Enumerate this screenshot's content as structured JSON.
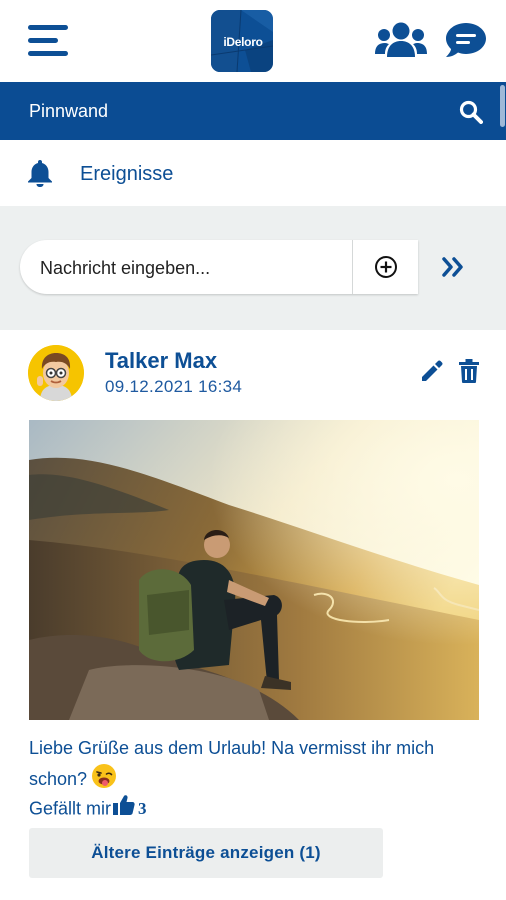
{
  "app": {
    "logo_text": "iDeloro",
    "brand_color": "#0b4c93"
  },
  "header": {
    "title": "Pinnwand",
    "icons": [
      "menu-icon",
      "users-icon",
      "chat-icon",
      "search-icon"
    ]
  },
  "events": {
    "label": "Ereignisse",
    "icon": "bell-icon"
  },
  "composer": {
    "placeholder": "Nachricht eingeben...",
    "add_icon": "plus-circle-icon",
    "send_icon": "double-chevron-right-icon"
  },
  "post": {
    "author": "Talker Max",
    "date": "09.12.2021 16:34",
    "text": "Liebe Grüße aus dem Urlaub! Na vermisst ihr mich schon?",
    "emoji_icon": "winking-tongue-emoji-icon",
    "like_label": "Gefällt mir",
    "like_count": "3",
    "actions": [
      "edit-icon",
      "delete-icon"
    ]
  },
  "older_button": {
    "label": "Ältere Einträge anzeigen (1)"
  }
}
